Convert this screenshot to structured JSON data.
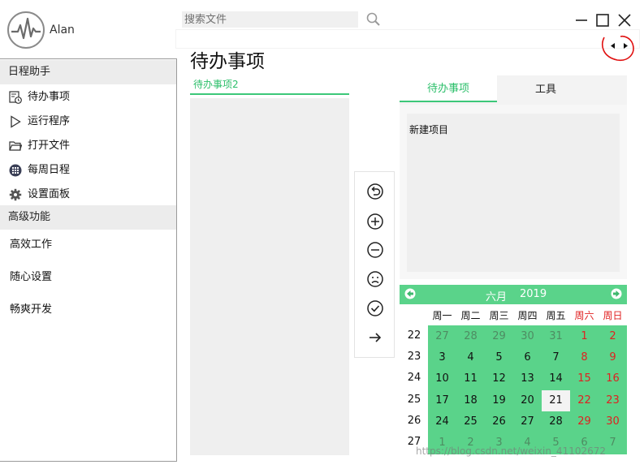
{
  "app": {
    "user_name": "Alan"
  },
  "search": {
    "placeholder": "搜索文件"
  },
  "sidebar": {
    "section1": "日程助手",
    "items1": [
      {
        "label": "待办事项",
        "icon": "clock-list-icon"
      },
      {
        "label": "运行程序",
        "icon": "play-icon"
      },
      {
        "label": "打开文件",
        "icon": "folder-icon"
      },
      {
        "label": "每周日程",
        "icon": "calendar-grid-icon"
      },
      {
        "label": "设置面板",
        "icon": "gear-icon"
      }
    ],
    "section2": "高级功能",
    "items2": [
      {
        "label": "高效工作"
      },
      {
        "label": "随心设置"
      },
      {
        "label": "畅爽开发"
      }
    ]
  },
  "main": {
    "title": "待办事项",
    "todo_list": [
      "待办事项2"
    ],
    "toolbar": [
      "undo-icon",
      "add-icon",
      "remove-icon",
      "sad-face-icon",
      "check-icon",
      "arrow-right-icon"
    ]
  },
  "right": {
    "tabs": [
      "待办事项",
      "工具"
    ],
    "new_item": "新建项目"
  },
  "calendar": {
    "month": "六月",
    "year": "2019",
    "weekdays": [
      "周一",
      "周二",
      "周三",
      "周四",
      "周五",
      "周六",
      "周日"
    ],
    "weeks": [
      22,
      23,
      24,
      25,
      26,
      27
    ],
    "days": [
      [
        27,
        28,
        29,
        30,
        31,
        1,
        2
      ],
      [
        3,
        4,
        5,
        6,
        7,
        8,
        9
      ],
      [
        10,
        11,
        12,
        13,
        14,
        15,
        16
      ],
      [
        17,
        18,
        19,
        20,
        21,
        22,
        23
      ],
      [
        24,
        25,
        26,
        27,
        28,
        29,
        30
      ],
      [
        1,
        2,
        3,
        4,
        5,
        6,
        7
      ]
    ],
    "today": 21
  },
  "watermark": "https://blog.csdn.net/weixin_41102672",
  "colors": {
    "accent": "#3cc779",
    "calendar": "#5ad38a",
    "weekend": "#e02020"
  }
}
